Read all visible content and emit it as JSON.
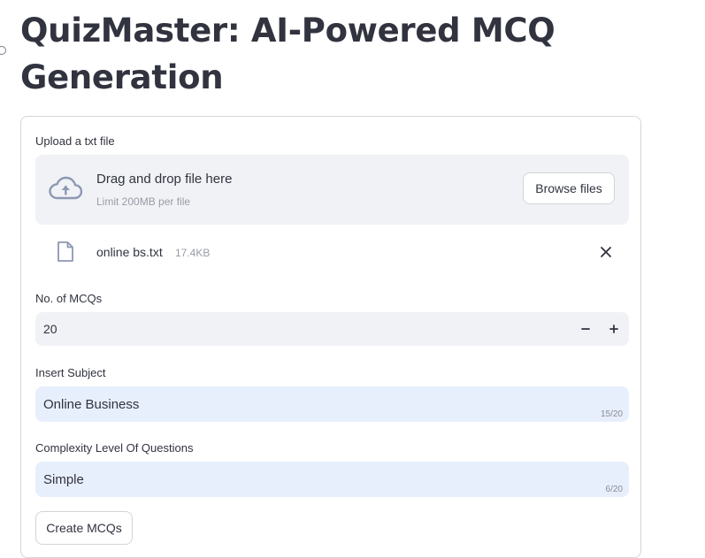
{
  "page": {
    "title": "QuizMaster: AI-Powered MCQ Generation"
  },
  "uploader": {
    "label": "Upload a txt file",
    "drop_text": "Drag and drop file here",
    "limit_text": "Limit 200MB per file",
    "browse_label": "Browse files",
    "file": {
      "name": "online bs.txt",
      "size": "17.4KB"
    }
  },
  "mcq_count": {
    "label": "No. of MCQs",
    "value": "20",
    "decrement": "−",
    "increment": "+"
  },
  "subject": {
    "label": "Insert Subject",
    "value": "Online Business",
    "counter": "15/20"
  },
  "complexity": {
    "label": "Complexity Level Of Questions",
    "value": "Simple",
    "counter": "6/20"
  },
  "create_button": {
    "label": "Create MCQs"
  },
  "colors": {
    "text": "#31333f",
    "muted": "#9a9ca6",
    "input_bg": "#f0f2f6",
    "text_input_bg": "#e8effc",
    "icon": "#8d98b2"
  },
  "icons": {
    "upload": "cloud-upload-icon",
    "file": "file-icon",
    "remove": "close-icon"
  }
}
